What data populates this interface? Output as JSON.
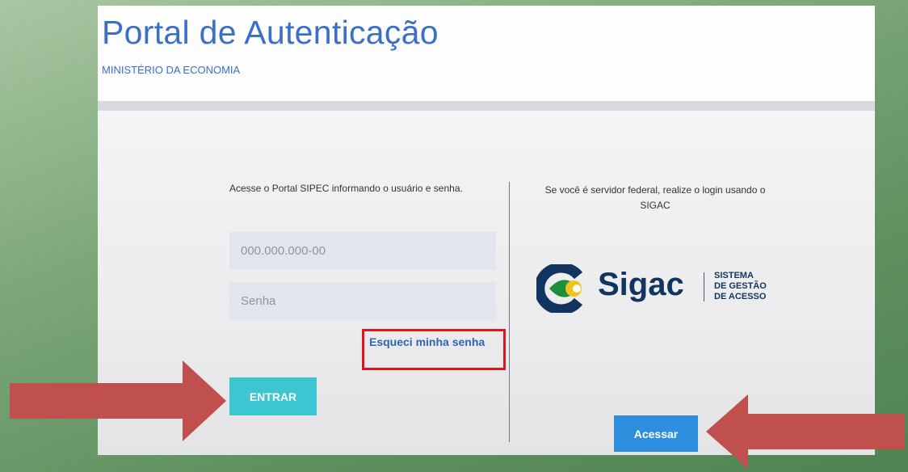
{
  "header": {
    "title": "Portal de Autenticação",
    "subtitle": "MINISTÉRIO DA ECONOMIA"
  },
  "login": {
    "intro": "Acesse o Portal SIPEC informando o usuário e senha.",
    "cpf_placeholder": "000.000.000-00",
    "password_placeholder": "Senha",
    "forgot_label": "Esqueci minha senha",
    "submit_label": "ENTRAR"
  },
  "sigac": {
    "intro": "Se você é servidor federal, realize o login usando o SIGAC",
    "logo_text": "Sigac",
    "tagline": [
      "SISTEMA",
      "DE GESTÃO",
      "DE ACESSO"
    ],
    "button_label": "Acessar"
  },
  "colors": {
    "title_blue": "#3c6fc6",
    "entrar_button": "#3cc6d1",
    "acessar_button": "#2f8fdf",
    "highlight_box": "#e4121c",
    "arrow": "#c0504d",
    "sigac_navy": "#11355e",
    "sigac_green": "#1f8e3b",
    "sigac_yellow": "#f2c318"
  },
  "icons": {
    "sigac_emblem": "sigac-logo-icon",
    "left_arrow": "right-pointing-arrow-icon",
    "right_arrow": "left-pointing-arrow-icon"
  }
}
